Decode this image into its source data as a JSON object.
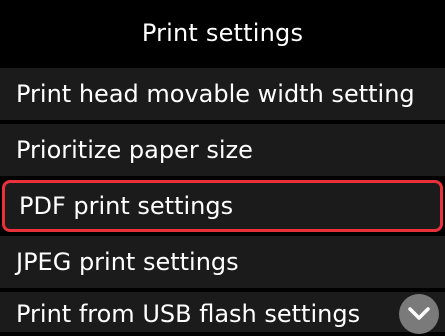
{
  "header": {
    "title": "Print settings"
  },
  "menu": {
    "items": [
      {
        "label": "Print head movable width setting",
        "selected": false
      },
      {
        "label": "Prioritize paper size",
        "selected": false
      },
      {
        "label": "PDF print settings",
        "selected": true
      },
      {
        "label": "JPEG print settings",
        "selected": false
      },
      {
        "label": "Print from USB flash settings",
        "selected": false
      }
    ]
  },
  "controls": {
    "scroll_down_icon": "chevron-down-icon"
  },
  "colors": {
    "background": "#000000",
    "item_background": "#1b1b1b",
    "selection_border": "#e8313a",
    "scroll_button": "#7a7a7a",
    "text": "#ffffff"
  }
}
